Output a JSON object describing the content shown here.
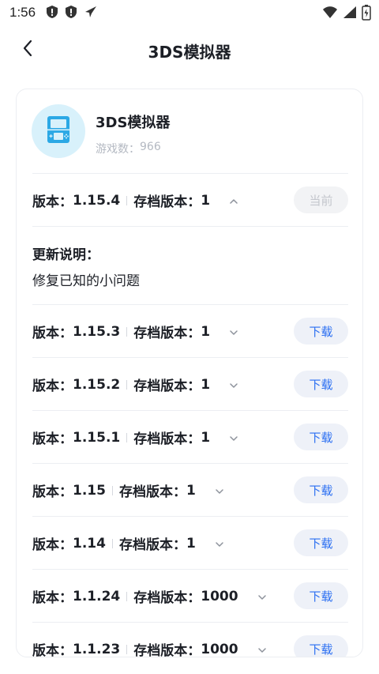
{
  "status_bar": {
    "time": "1:56",
    "left_icons": [
      "shield-alert-icon",
      "shield-alert-icon",
      "airplane-icon"
    ],
    "right_icons": [
      "wifi-icon",
      "cellular-signal-icon",
      "battery-icon"
    ]
  },
  "header": {
    "title": "3DS模拟器",
    "back_icon": "chevron-left-icon"
  },
  "app": {
    "name": "3DS模拟器",
    "game_count_label": "游戏数：",
    "game_count_value": "966",
    "logo_icon": "handheld-console-icon",
    "logo_bg": "#d8f1fb",
    "logo_fg": "#2ba8e5"
  },
  "labels": {
    "version_prefix": "版本：",
    "save_version_prefix": "存档版本："
  },
  "versions": [
    {
      "version": "1.15.4",
      "save_version": "1",
      "expanded": true,
      "action": "当前",
      "is_current": true
    },
    {
      "version": "1.15.3",
      "save_version": "1",
      "expanded": false,
      "action": "下载",
      "is_current": false
    },
    {
      "version": "1.15.2",
      "save_version": "1",
      "expanded": false,
      "action": "下载",
      "is_current": false
    },
    {
      "version": "1.15.1",
      "save_version": "1",
      "expanded": false,
      "action": "下载",
      "is_current": false
    },
    {
      "version": "1.15",
      "save_version": "1",
      "expanded": false,
      "action": "下载",
      "is_current": false
    },
    {
      "version": "1.14",
      "save_version": "1",
      "expanded": false,
      "action": "下载",
      "is_current": false
    },
    {
      "version": "1.1.24",
      "save_version": "1000",
      "expanded": false,
      "action": "下载",
      "is_current": false
    },
    {
      "version": "1.1.23",
      "save_version": "1000",
      "expanded": false,
      "action": "下载",
      "is_current": false
    }
  ],
  "update_notes": {
    "title": "更新说明：",
    "body": "修复已知的小问题"
  },
  "colors": {
    "accent": "#2b6ff2",
    "button_bg": "#eef1f8",
    "current_button_text": "#c4c7cd",
    "text_primary": "#1c1f26",
    "text_muted": "#b4b9c2"
  }
}
